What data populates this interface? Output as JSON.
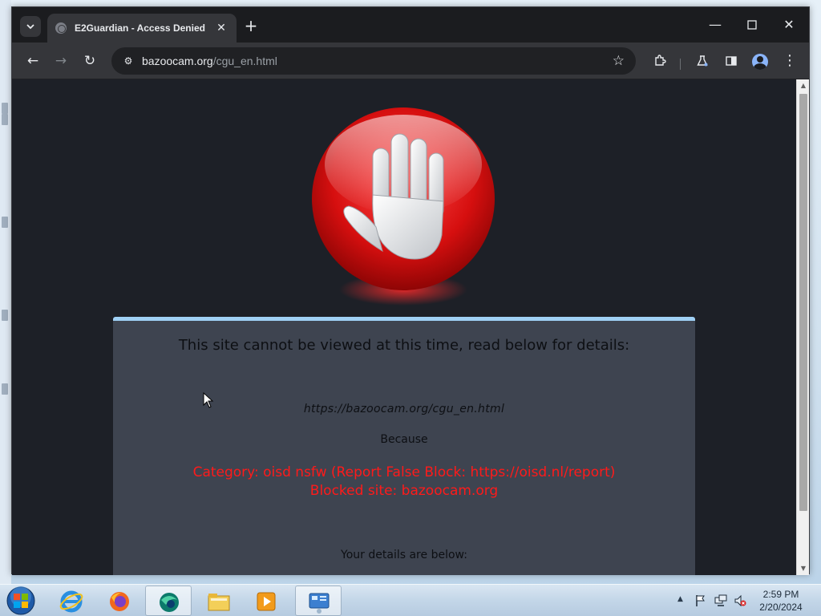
{
  "browser": {
    "tab": {
      "title": "E2Guardian - Access Denied"
    },
    "address_bar": {
      "host": "bazoocam.org",
      "path": "/cgu_en.html"
    },
    "icons": [
      "tab-search-icon",
      "back-arrow-icon",
      "forward-arrow-icon",
      "reload-icon",
      "site-info-icon",
      "bookmark-star-icon",
      "extensions-icon",
      "labs-flask-icon",
      "side-panel-icon",
      "profile-icon",
      "menu-kebab-icon",
      "minimize-icon",
      "maximize-icon",
      "close-icon"
    ]
  },
  "page": {
    "heading": "This site cannot be viewed at this time, read below for details:",
    "blocked_url": "https://bazoocam.org/cgu_en.html",
    "because_label": "Because",
    "reason_line1": "Category: oisd nsfw (Report False Block: https://oisd.nl/report)",
    "reason_line2": "Blocked site: bazoocam.org",
    "details_label": "Your details are below:",
    "reason_color": "#ff1a1a",
    "panel_accent": "#9fd0f5",
    "illustration": "stop-hand-icon"
  },
  "taskbar": {
    "apps": [
      "windows-start-orb",
      "internet-explorer-icon",
      "firefox-icon",
      "browser-app-icon",
      "file-explorer-icon",
      "media-player-icon",
      "control-panel-icon"
    ],
    "tray_icons": [
      "show-hidden-icons-arrow",
      "action-center-flag-icon",
      "network-icon",
      "volume-muted-icon"
    ],
    "time": "2:59 PM",
    "date": "2/20/2024"
  }
}
